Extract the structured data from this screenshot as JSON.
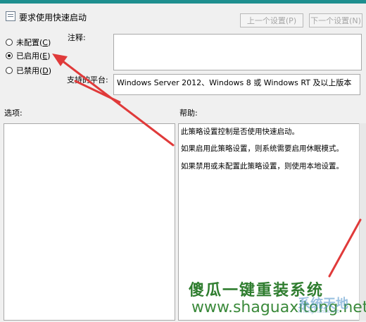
{
  "header": {
    "title": "要求使用快速启动",
    "prev_button": "上一个设置(P)",
    "next_button": "下一个设置(N)"
  },
  "state_options": [
    {
      "label": "未配置(",
      "hotkey": "C",
      "suffix": ")",
      "checked": false
    },
    {
      "label": "已启用(",
      "hotkey": "E",
      "suffix": ")",
      "checked": true
    },
    {
      "label": "已禁用(",
      "hotkey": "D",
      "suffix": ")",
      "checked": false
    }
  ],
  "fields": {
    "comment_label": "注释:",
    "comment_value": "",
    "platform_label": "支持的平台:",
    "platform_value": "Windows Server 2012、Windows 8 或 Windows RT 及以上版本"
  },
  "sections": {
    "options_label": "选项:",
    "help_label": "帮助:"
  },
  "help_text": [
    "此策略设置控制是否使用快速启动。",
    "如果启用此策略设置，则系统需要启用休眠模式。",
    "如果禁用或未配置此策略设置，则使用本地设置。"
  ],
  "watermark": {
    "brand": "傻瓜一键重装系统",
    "url": "www.shaguaxitong.net",
    "logo_main": "系统天地",
    "logo_sub": "XiTongTianDi.net"
  },
  "colors": {
    "accent_strip": "#1e8f8f",
    "annotation_arrow": "#e03a3a",
    "watermark_green": "#2f7d2f"
  },
  "icons": {
    "policy": "policy-document-icon",
    "annotation": "red-arrow-annotation"
  }
}
